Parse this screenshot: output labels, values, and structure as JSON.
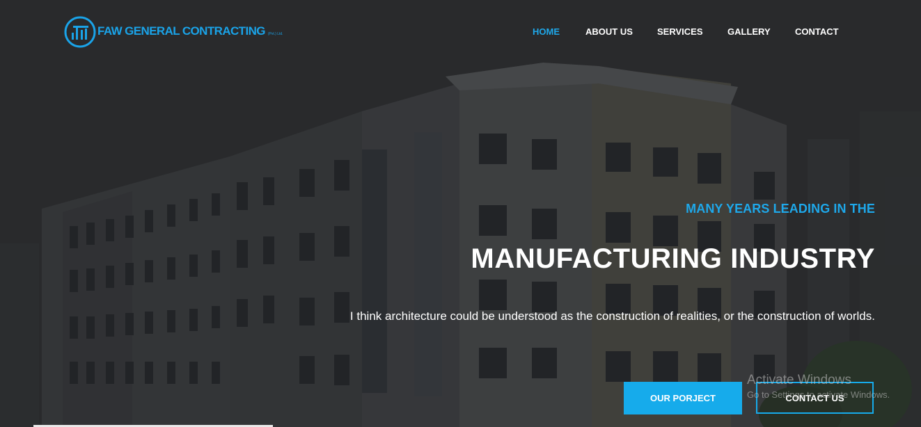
{
  "logo": {
    "name": "FAW GENERAL CONTRACTING",
    "suffix": "(Pvt.) Ltd."
  },
  "nav": {
    "items": [
      {
        "label": "HOME",
        "active": true
      },
      {
        "label": "ABOUT US",
        "active": false
      },
      {
        "label": "SERVICES",
        "active": false
      },
      {
        "label": "GALLERY",
        "active": false
      },
      {
        "label": "CONTACT",
        "active": false
      }
    ]
  },
  "hero": {
    "tagline": "MANY YEARS LEADING IN THE",
    "headline": "MANUFACTURING INDUSTRY",
    "quote": "I think architecture could be understood as the construction of realities, or the construction of worlds.",
    "primary_button": "OUR PORJECT",
    "secondary_button": "CONTACT US"
  },
  "watermark": {
    "line1": "Activate Windows",
    "line2": "Go to Settings to activate Windows."
  },
  "colors": {
    "accent": "#1ea8ea",
    "text": "#ffffff",
    "background": "#2b2c2e"
  }
}
